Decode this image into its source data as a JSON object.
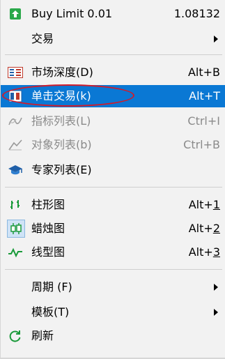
{
  "menu": {
    "buy_limit": {
      "label": "Buy Limit 0.01",
      "value": "1.08132",
      "icon": "green-up-arrow-icon"
    },
    "trade": {
      "label": "交易",
      "submenu": true
    },
    "market_depth": {
      "label": "市场深度(D)",
      "shortcut": "Alt+B",
      "icon": "market-depth-icon"
    },
    "one_click": {
      "label": "单击交易(k)",
      "shortcut": "Alt+T",
      "icon": "one-click-trading-icon",
      "selected": true
    },
    "indicator_list": {
      "label": "指标列表(L)",
      "shortcut": "Ctrl+I",
      "icon": "indicator-list-icon",
      "disabled": true
    },
    "object_list": {
      "label": "对象列表(b)",
      "shortcut": "Ctrl+B",
      "icon": "object-list-icon",
      "disabled": true
    },
    "expert_list": {
      "label": "专家列表(E)",
      "icon": "graduation-cap-icon"
    },
    "bar_chart": {
      "label": "柱形图",
      "shortcut_prefix": "Alt+",
      "shortcut_key": "1",
      "icon": "bar-chart-icon"
    },
    "candlestick": {
      "label": "蜡烛图",
      "shortcut_prefix": "Alt+",
      "shortcut_key": "2",
      "icon": "candlestick-icon"
    },
    "line_chart": {
      "label": "线型图",
      "shortcut_prefix": "Alt+",
      "shortcut_key": "3",
      "icon": "line-chart-icon"
    },
    "period": {
      "label": "周期 (F)",
      "submenu": true
    },
    "template": {
      "label": "模板(T)",
      "submenu": true
    },
    "refresh": {
      "label": "刷新",
      "icon": "refresh-icon"
    }
  },
  "colors": {
    "selection": "#0a78d4",
    "annotation_ellipse": "#d11b2a",
    "accent_green": "#1a9a3a",
    "accent_blue": "#1f5fa8"
  }
}
